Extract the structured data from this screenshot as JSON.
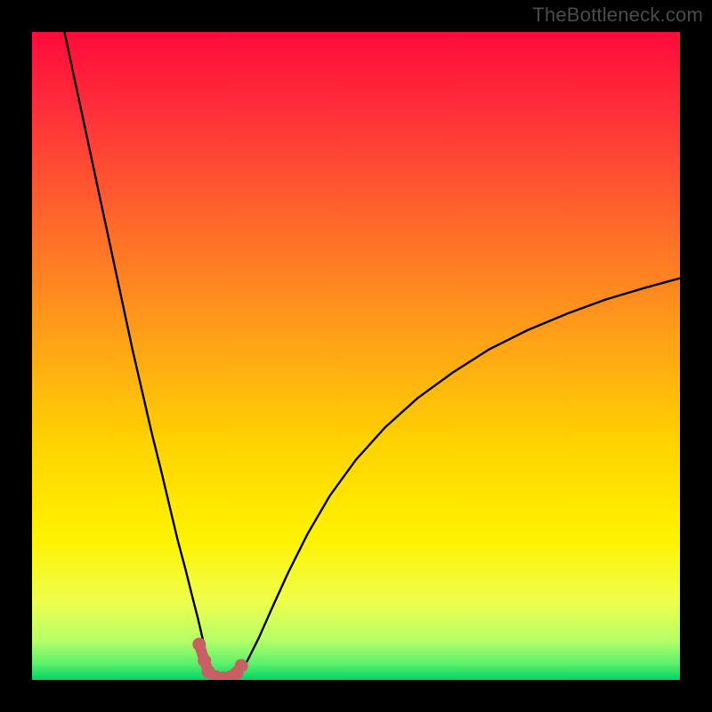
{
  "watermark": "TheBottleneck.com",
  "chart_data": {
    "type": "line",
    "title": "",
    "xlabel": "",
    "ylabel": "",
    "xlim": [
      0,
      100
    ],
    "ylim": [
      0,
      100
    ],
    "legend": false,
    "grid": false,
    "background_gradient": [
      "#ff0037",
      "#ff2f3a",
      "#ff6a2e",
      "#ffa11f",
      "#ffd400",
      "#fff200",
      "#f3ff4a",
      "#b7ff6a",
      "#00d468"
    ],
    "series": [
      {
        "name": "curve",
        "type": "line",
        "stroke": "#000000",
        "x": [
          5.0,
          6.5,
          8.0,
          9.5,
          11.0,
          12.5,
          14.0,
          15.5,
          17.0,
          18.5,
          20.0,
          21.3,
          22.5,
          23.7,
          24.7,
          25.6,
          26.3,
          26.8,
          27.1,
          27.2,
          27.5,
          28.5,
          29.5,
          30.5,
          31.5,
          32.2,
          32.7,
          33.5,
          35.0,
          37.0,
          39.5,
          42.5,
          46.0,
          50.0,
          54.5,
          59.5,
          65.0,
          70.5,
          76.5,
          82.5,
          88.5,
          94.5,
          100.0
        ],
        "y": [
          100.0,
          93.0,
          86.0,
          79.0,
          72.0,
          65.0,
          58.0,
          51.0,
          44.5,
          38.0,
          32.0,
          26.5,
          21.5,
          17.0,
          13.0,
          9.5,
          6.5,
          4.2,
          2.5,
          1.4,
          0.8,
          0.4,
          0.3,
          0.4,
          0.7,
          1.2,
          2.0,
          3.5,
          6.5,
          11.0,
          16.5,
          22.5,
          28.5,
          34.0,
          39.0,
          43.5,
          47.5,
          51.0,
          54.0,
          56.5,
          58.7,
          60.5,
          62.0
        ]
      },
      {
        "name": "markers",
        "type": "scatter",
        "stroke": "#c76064",
        "fill": "#c76064",
        "x": [
          25.8,
          26.6,
          27.2,
          28.3,
          29.5,
          30.7,
          31.6,
          32.3
        ],
        "y": [
          5.5,
          3.0,
          1.3,
          0.5,
          0.3,
          0.5,
          1.1,
          2.2
        ]
      }
    ]
  }
}
